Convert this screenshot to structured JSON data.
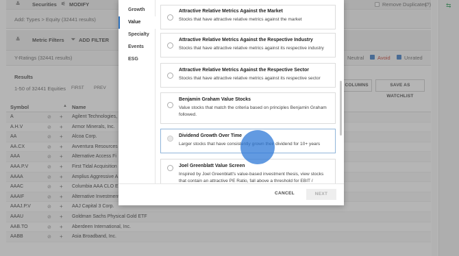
{
  "toolbar": {
    "securities_label": "Securities",
    "modify_label": "MODIFY",
    "remove_duplicates_label": "Remove Duplicates",
    "help_label": "(?)",
    "add_types_text": "Add: Types > Equity (32441 results)"
  },
  "filters": {
    "metric_filters_label": "Metric Filters",
    "add_filter_label": "ADD FILTER",
    "y_ratings_text": "Y-Ratings (32441 results)",
    "rating_options": [
      {
        "label": "Neutral",
        "checked": false
      },
      {
        "label": "Avoid",
        "checked": true
      },
      {
        "label": "Unrated",
        "checked": true
      }
    ]
  },
  "results": {
    "title": "Results",
    "range_text": "1-50 of 32441 Equities",
    "first_label": "FIRST",
    "prev_label": "PREV",
    "columns_button": "O COLUMNS",
    "save_watchlist_button": "SAVE AS WATCHLIST"
  },
  "table": {
    "symbol_header": "Symbol",
    "name_header": "Name",
    "rows": [
      {
        "symbol": "A",
        "name": "Agilent Technologies,"
      },
      {
        "symbol": "A.H.V",
        "name": "Armor Minerals, Inc."
      },
      {
        "symbol": "AA",
        "name": "Alcoa Corp."
      },
      {
        "symbol": "AA.CX",
        "name": "Avventura Resources"
      },
      {
        "symbol": "AAA",
        "name": "Alternative Access Fi"
      },
      {
        "symbol": "AAA.P.V",
        "name": "First Tidal Acquisition"
      },
      {
        "symbol": "AAAA",
        "name": "Amplius Aggressive A"
      },
      {
        "symbol": "AAAC",
        "name": "Columbia AAA CLO E"
      },
      {
        "symbol": "AAAIF",
        "name": "Alternative Investment Trust"
      },
      {
        "symbol": "AAAJ.P.V",
        "name": "AAJ Capital 3 Corp."
      },
      {
        "symbol": "AAAU",
        "name": "Goldman Sachs Physical Gold ETF"
      },
      {
        "symbol": "AAB.TO",
        "name": "Aberdeen International, Inc."
      },
      {
        "symbol": "AABB",
        "name": "Asia Broadband, Inc."
      }
    ]
  },
  "modal": {
    "categories": [
      {
        "label": "Growth",
        "active": false
      },
      {
        "label": "Value",
        "active": true
      },
      {
        "label": "Specialty",
        "active": false
      },
      {
        "label": "Events",
        "active": false
      },
      {
        "label": "ESG",
        "active": false
      }
    ],
    "screens": [
      {
        "title": "Attractive Relative Metrics Against the Market",
        "desc": "Stocks that have attractive relative metrics against the market"
      },
      {
        "title": "Attractive Relative Metrics Against the Respective Industry",
        "desc": "Stocks that have attractive relative metrics against its respective industry"
      },
      {
        "title": "Attractive Relative Metrics Against the Respective Sector",
        "desc": "Stocks that have attractive relative metrics against its respective sector"
      },
      {
        "title": "Benjamin Graham Value Stocks",
        "desc": "Value stocks that match the criteria based on principles Benjamin Graham followed."
      },
      {
        "title": "Dividend Growth Over Time",
        "desc": "Larger stocks that have consistently grown their dividend for 10+ years"
      },
      {
        "title": "Joel Greenblatt Value Screen",
        "desc": "Inspired by Joel Greenblatt's value-based investment thesis, view stocks that contain an attractive PE Ratio, fall above a threshold for EBIT / enterprise value,"
      }
    ],
    "cancel_label": "CANCEL",
    "next_label": "NEXT"
  },
  "colors": {
    "accent": "#2a6fbb",
    "click_indicator": "#2d78d7"
  }
}
